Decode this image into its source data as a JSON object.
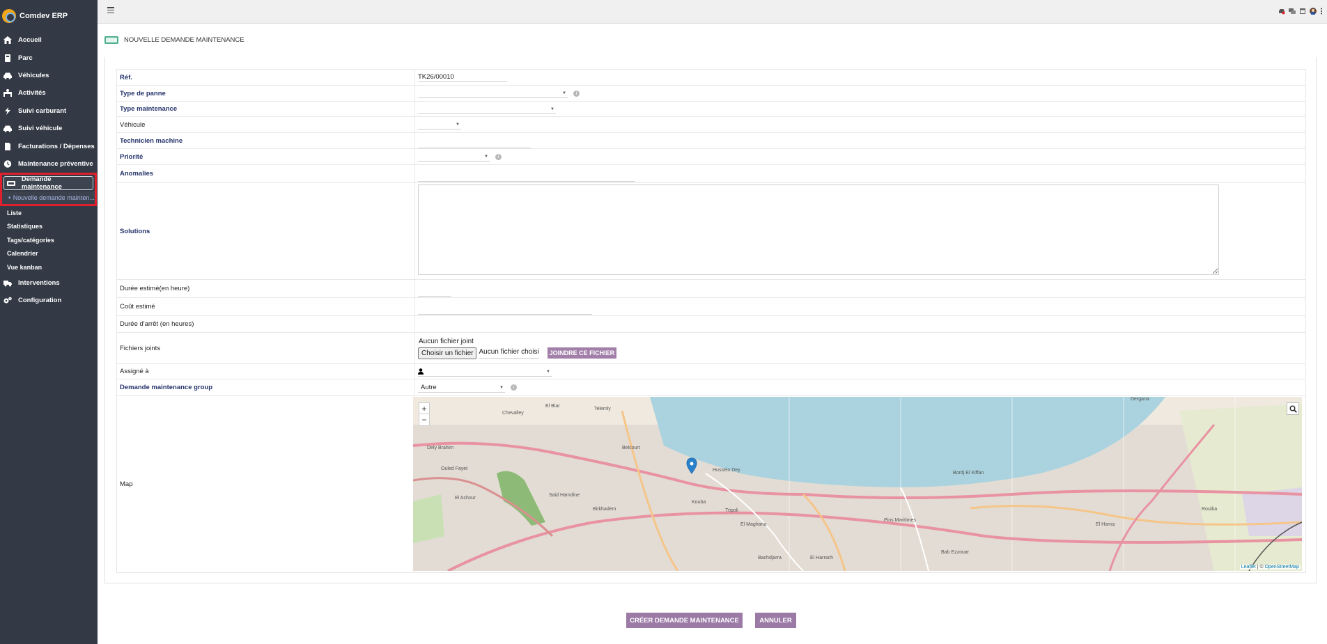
{
  "app": {
    "name": "Comdev ERP"
  },
  "sidebar": {
    "items": [
      {
        "label": "Accueil",
        "icon": "home-icon"
      },
      {
        "label": "Parc",
        "icon": "parc-icon"
      },
      {
        "label": "Véhicules",
        "icon": "car-icon"
      },
      {
        "label": "Activités",
        "icon": "activity-icon"
      },
      {
        "label": "Suivi carburant",
        "icon": "bolt-icon"
      },
      {
        "label": "Suivi véhicule",
        "icon": "car-icon"
      },
      {
        "label": "Facturations / Dépenses",
        "icon": "file-icon"
      },
      {
        "label": "Maintenance préventive",
        "icon": "clock-icon"
      }
    ],
    "active": {
      "label": "Demande maintenance",
      "icon": "ticket-icon"
    },
    "active_sub": "+ Nouvelle demande mainten...",
    "sub_items": [
      "Liste",
      "Statistiques",
      "Tags/catégories",
      "Calendrier",
      "Vue kanban"
    ],
    "bottom_items": [
      {
        "label": "Interventions",
        "icon": "truck-icon"
      },
      {
        "label": "Configuration",
        "icon": "cogs-icon"
      }
    ]
  },
  "page": {
    "title": "NOUVELLE DEMANDE MAINTENANCE"
  },
  "form": {
    "ref": {
      "label": "Réf.",
      "value": "TK26/00010"
    },
    "type_panne": {
      "label": "Type de panne"
    },
    "type_maintenance": {
      "label": "Type maintenance"
    },
    "vehicule": {
      "label": "Véhicule"
    },
    "technicien": {
      "label": "Technicien machine"
    },
    "priorite": {
      "label": "Priorité"
    },
    "anomalies": {
      "label": "Anomalies"
    },
    "solutions": {
      "label": "Solutions"
    },
    "duree": {
      "label": "Durée estimé(en heure)"
    },
    "cout": {
      "label": "Coût estimé"
    },
    "duree_arret": {
      "label": "Durée d'arrêt (en heures)"
    },
    "fichiers": {
      "label": "Fichiers joints",
      "none_text": "Aucun fichier joint",
      "choose_label": "Choisir un fichier",
      "no_file_chosen": "Aucun fichier choisi",
      "join_label": "JOINDRE CE FICHIER"
    },
    "assigne": {
      "label": "Assigné à"
    },
    "group": {
      "label": "Demande maintenance group",
      "value": "Autre"
    },
    "map": {
      "label": "Map"
    }
  },
  "map": {
    "zoom_in": "+",
    "zoom_out": "−",
    "attribution_leaflet": "Leaflet",
    "attribution_sep": " | © ",
    "attribution_osm": "OpenStreetMap",
    "places": [
      "Chevalley",
      "El Biar",
      "Telemly",
      "Belcourt",
      "Hussein Dey",
      "Kouba",
      "Dely Brahim",
      "Ouled Fayet",
      "El Achour",
      "Said Hamdine",
      "Birkhadem",
      "Bachdjarra",
      "El Harrach",
      "Pins Maritimes",
      "Bab Ezzouar",
      "Bordj El Kiffan",
      "El Hamiz",
      "Rouiba",
      "Dergana",
      "Tripoli",
      "El Magharia"
    ],
    "colors": {
      "sea": "#aad3df",
      "land": "#efe9df",
      "park": "#8dbb77",
      "road": "#e8a6b4"
    }
  },
  "actions": {
    "create": "CRÉER DEMANDE MAINTENANCE",
    "cancel": "ANNULER"
  },
  "colors": {
    "sidebar": "#333a45",
    "accent": "#9c7aa6",
    "active_border": "#e0212d",
    "required_label": "#24336b"
  }
}
